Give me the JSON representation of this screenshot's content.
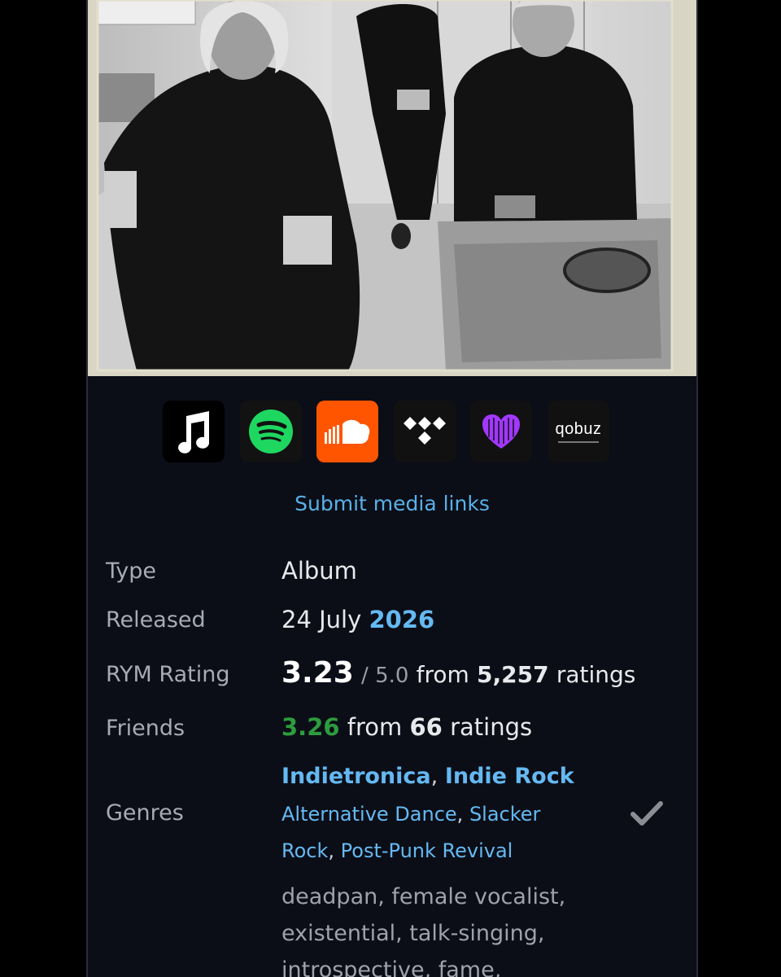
{
  "media": {
    "submit_label": "Submit media links",
    "services": [
      {
        "name": "apple-music",
        "bg": "#000000"
      },
      {
        "name": "spotify",
        "bg": "#121212"
      },
      {
        "name": "soundcloud",
        "bg": "#ff5500"
      },
      {
        "name": "tidal",
        "bg": "#111111"
      },
      {
        "name": "deezer",
        "bg": "#111111"
      },
      {
        "name": "qobuz",
        "bg": "#111111",
        "text": "qobuz"
      }
    ]
  },
  "info": {
    "type_label": "Type",
    "type_value": "Album",
    "released_label": "Released",
    "released_day_month": "24 July",
    "released_year": "2026",
    "rating_label": "RYM Rating",
    "rating_value": "3.23",
    "rating_scale": "/ 5.0",
    "rating_from": "from",
    "rating_count": "5,257",
    "rating_suffix": "ratings",
    "friends_label": "Friends",
    "friends_value": "3.26",
    "friends_from": "from",
    "friends_count": "66",
    "friends_suffix": "ratings",
    "genres_label": "Genres",
    "primary_genres": [
      "Indietronica",
      "Indie Rock"
    ],
    "secondary_genres": [
      "Alternative Dance",
      "Slacker Rock",
      "Post-Punk Revival"
    ],
    "descriptors_lines": [
      "deadpan, female vocalist,",
      "existential, talk-singing,",
      "introspective, fame,"
    ]
  },
  "colors": {
    "background": "#0b0e17",
    "link": "#65b9f2",
    "friends_rating": "#2d9c3d"
  }
}
